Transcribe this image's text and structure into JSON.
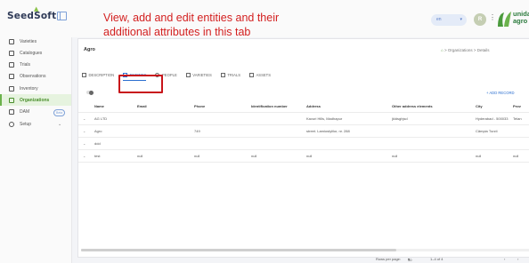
{
  "app": {
    "logo": "SeedSoft"
  },
  "sidebar": {
    "items": [
      {
        "label": "Varieties",
        "icon": "list-icon"
      },
      {
        "label": "Catalogues",
        "icon": "catalogue-icon"
      },
      {
        "label": "Trials",
        "icon": "trials-icon"
      },
      {
        "label": "Observations",
        "icon": "observations-icon"
      },
      {
        "label": "Inventory",
        "icon": "inventory-icon"
      },
      {
        "label": "Organizations",
        "icon": "organizations-icon",
        "active": true
      },
      {
        "label": "DAM",
        "icon": "folder-icon",
        "badge": "Beta"
      },
      {
        "label": "Setup",
        "icon": "gear-icon"
      }
    ]
  },
  "annotation": {
    "text": "View, add and edit entities and their additional attributes in this tab",
    "color": "#d32020"
  },
  "header": {
    "language": "en",
    "avatar_initial": "R",
    "org_logo_text": "unida agro"
  },
  "page": {
    "title": "Agro",
    "breadcrumb": {
      "parent": "Organizations",
      "current": "Details"
    }
  },
  "tabs": [
    {
      "label": "DESCRIPTION"
    },
    {
      "label": "ENTITIES",
      "active": true
    },
    {
      "label": "PEOPLE"
    },
    {
      "label": "VARIETIES"
    },
    {
      "label": "TRIALS"
    },
    {
      "label": "ASSETS"
    }
  ],
  "table": {
    "add_record": "+ ADD RECORD",
    "columns": [
      "Name",
      "Email",
      "Phone",
      "Identification number",
      "Address",
      "Other address elements",
      "City",
      "Prov"
    ],
    "rows": [
      [
        "AG LTD",
        "",
        "",
        "",
        "Kavuri Hills, Madhapur",
        "jkldsghjsd",
        "Hyderabad - 500033",
        "Telan"
      ],
      [
        "Agro",
        "",
        "749",
        "",
        "street. Lamiostylilor, nr. 288",
        "",
        "Cămpia Turzii",
        ""
      ],
      [
        "ddd",
        "",
        "",
        "",
        "",
        "",
        "",
        ""
      ],
      [
        "test",
        "null",
        "null",
        "null",
        "null",
        "null",
        "null",
        "null"
      ]
    ]
  },
  "pagination": {
    "rows_per_page_label": "Rows per page:",
    "rows_per_page": "50",
    "range": "1–4 of 4"
  },
  "colors": {
    "accent": "#2c6fd0",
    "active_nav": "#4a8f2c",
    "highlight": "#c8141a"
  }
}
